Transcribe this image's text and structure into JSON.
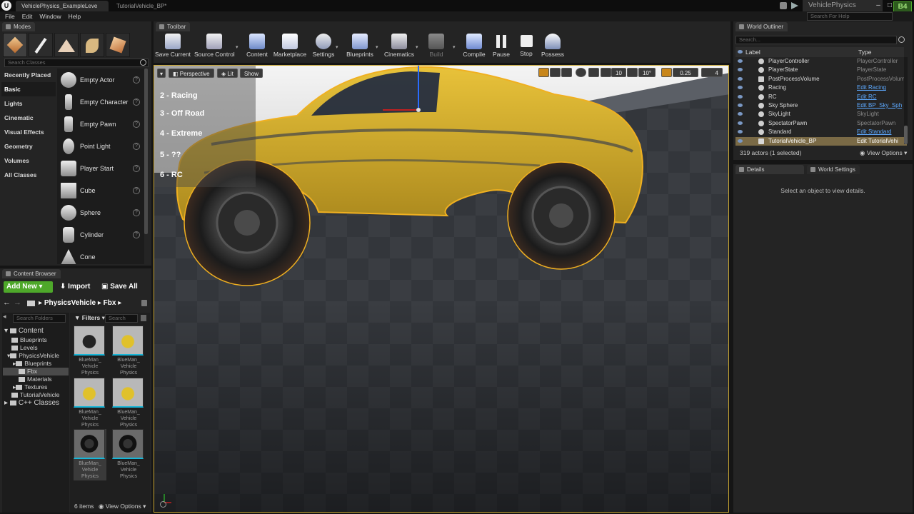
{
  "titlebar": {
    "tabs": [
      "VehiclePhysics_ExampleLeve",
      "TutorialVehicle_BP*"
    ],
    "project_name": "VehiclePhysics",
    "help_search_placeholder": "Search For Help"
  },
  "menu": [
    "File",
    "Edit",
    "Window",
    "Help"
  ],
  "modes": {
    "tab": "Modes",
    "search_placeholder": "Search Classes",
    "categories": [
      "Recently Placed",
      "Basic",
      "Lights",
      "Cinematic",
      "Visual Effects",
      "Geometry",
      "Volumes",
      "All Classes"
    ],
    "active_category": "Basic",
    "actors": [
      "Empty Actor",
      "Empty Character",
      "Empty Pawn",
      "Point Light",
      "Player Start",
      "Cube",
      "Sphere",
      "Cylinder",
      "Cone"
    ]
  },
  "content_browser": {
    "tab": "Content Browser",
    "add_new": "Add New",
    "import": "Import",
    "save_all": "Save All",
    "path": [
      "PhysicsVehicle",
      "Fbx"
    ],
    "search_folders_placeholder": "Search Folders",
    "filters": "Filters",
    "search_placeholder": "Search",
    "tree": [
      {
        "label": "Content",
        "indent": 0
      },
      {
        "label": "Blueprints",
        "indent": 1
      },
      {
        "label": "Levels",
        "indent": 1
      },
      {
        "label": "PhysicsVehicle",
        "indent": 1
      },
      {
        "label": "Blueprints",
        "indent": 2
      },
      {
        "label": "Fbx",
        "indent": 2
      },
      {
        "label": "Materials",
        "indent": 2
      },
      {
        "label": "Textures",
        "indent": 2
      },
      {
        "label": "TutorialVehicle",
        "indent": 1
      },
      {
        "label": "C++ Classes",
        "indent": 0
      }
    ],
    "selected_folder": "Fbx",
    "assets": [
      {
        "label": "BlueMan_ Vehicle Physics",
        "kind": "dark"
      },
      {
        "label": "BlueMan_ Vehicle Physics",
        "kind": "yellow"
      },
      {
        "label": "BlueMan_ Vehicle Physics",
        "kind": "yellow"
      },
      {
        "label": "BlueMan_ Vehicle Physics",
        "kind": "yellow"
      },
      {
        "label": "BlueMan_ Vehicle Physics",
        "kind": "wheel"
      },
      {
        "label": "BlueMan_ Vehicle Physics",
        "kind": "wheel"
      }
    ],
    "item_count": "6 items",
    "view_options": "View Options"
  },
  "toolbar": {
    "tab": "Toolbar",
    "buttons": [
      "Save Current",
      "Source Control",
      "Content",
      "Marketplace",
      "Settings",
      "Blueprints",
      "Cinematics",
      "Build",
      "Compile",
      "Pause",
      "Stop",
      "Possess"
    ]
  },
  "viewport": {
    "perspective": "Perspective",
    "lit": "Lit",
    "show": "Show",
    "grid_snap": "10",
    "rot_snap": "10°",
    "scale_snap": "0.25",
    "cam_speed": "4",
    "menu_items": [
      "2 - Racing",
      "3 - Off Road",
      "4 - Extreme",
      "5 - ??",
      "6 - RC"
    ]
  },
  "outliner": {
    "tab": "World Outliner",
    "search_placeholder": "Search...",
    "col_label": "Label",
    "col_type": "Type",
    "rows": [
      {
        "label": "PlayerController",
        "type": "PlayerController",
        "link": false
      },
      {
        "label": "PlayerState",
        "type": "PlayerState",
        "link": false
      },
      {
        "label": "PostProcessVolume",
        "type": "PostProcessVolum",
        "link": false
      },
      {
        "label": "Racing",
        "type": "Edit Racing",
        "link": true
      },
      {
        "label": "RC",
        "type": "Edit RC",
        "link": true
      },
      {
        "label": "Sky Sphere",
        "type": "Edit BP_Sky_Sph",
        "link": true
      },
      {
        "label": "SkyLight",
        "type": "SkyLight",
        "link": false
      },
      {
        "label": "SpectatorPawn",
        "type": "SpectatorPawn",
        "link": false
      },
      {
        "label": "Standard",
        "type": "Edit Standard",
        "link": true
      },
      {
        "label": "TutorialVehicle_BP",
        "type": "Edit TutorialVehi",
        "link": true
      }
    ],
    "selected_row": "TutorialVehicle_BP",
    "actor_count": "319 actors (1 selected)",
    "view_options": "View Options"
  },
  "details": {
    "tab": "Details",
    "world_settings_tab": "World Settings",
    "empty_text": "Select an object to view details."
  },
  "colors": {
    "accent_green": "#4ea82a",
    "selection_outline": "#f0b020",
    "link_blue": "#5da9ff",
    "asset_underline": "#17b6d8"
  }
}
